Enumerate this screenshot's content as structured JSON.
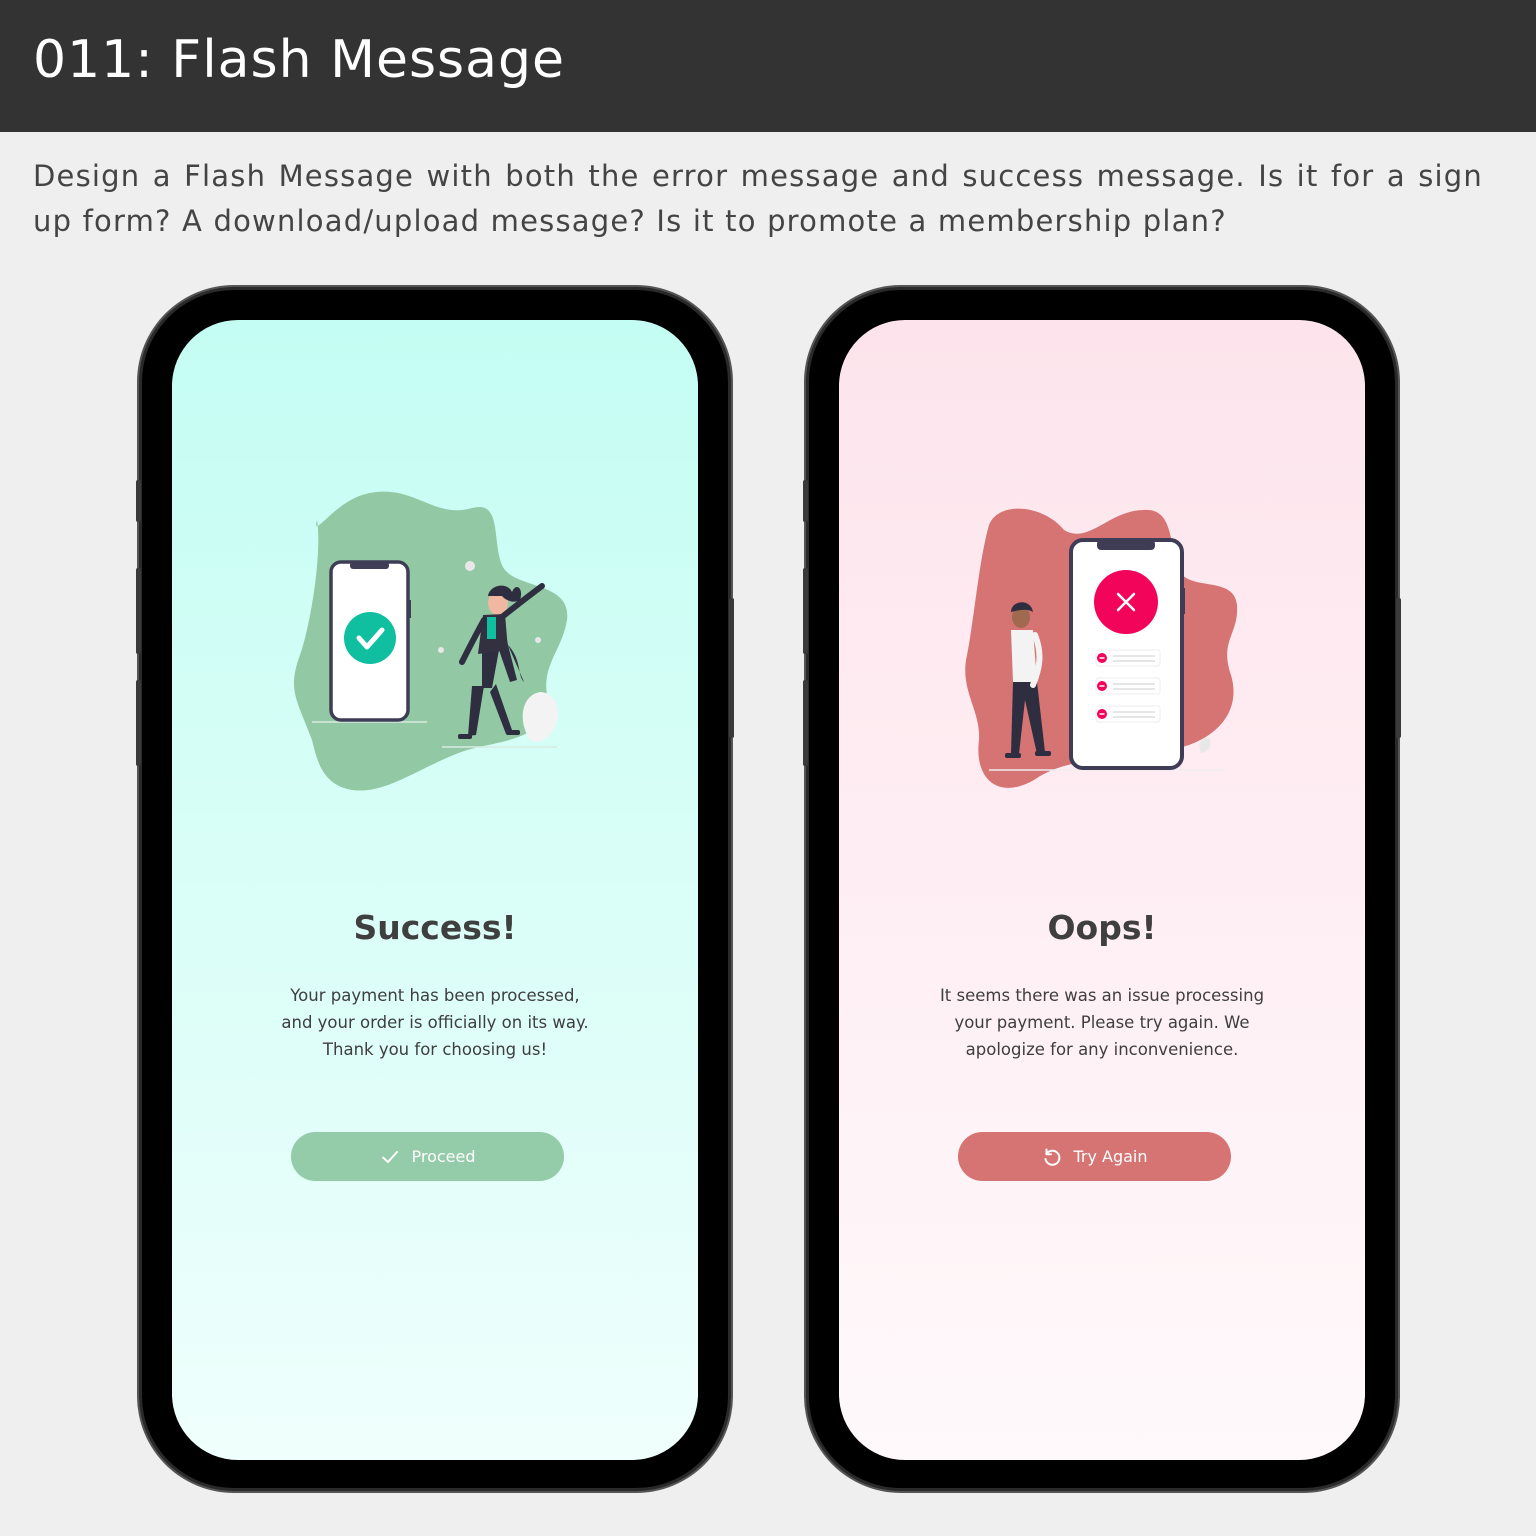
{
  "header": {
    "title": "011: Flash Message"
  },
  "description": "Design a Flash Message with both the error message and success message. Is it for a sign up form? A download/upload message? Is it to promote a membership plan?",
  "success_phone": {
    "title": "Success!",
    "message_lines": [
      "Your payment has been processed,",
      "and your order is officially on its way.",
      "Thank you for choosing us!"
    ],
    "button_label": "Proceed",
    "button_icon": "check-icon",
    "accent": "#94cba9",
    "badge_color": "#10bfa0"
  },
  "error_phone": {
    "title": "Oops!",
    "message_lines": [
      "It seems there was an issue processing",
      "your payment. Please  try again.  We",
      "apologize for any inconvenience."
    ],
    "button_label": "Try Again",
    "button_icon": "retry-icon",
    "accent": "#d67373",
    "badge_color": "#f2045a"
  }
}
